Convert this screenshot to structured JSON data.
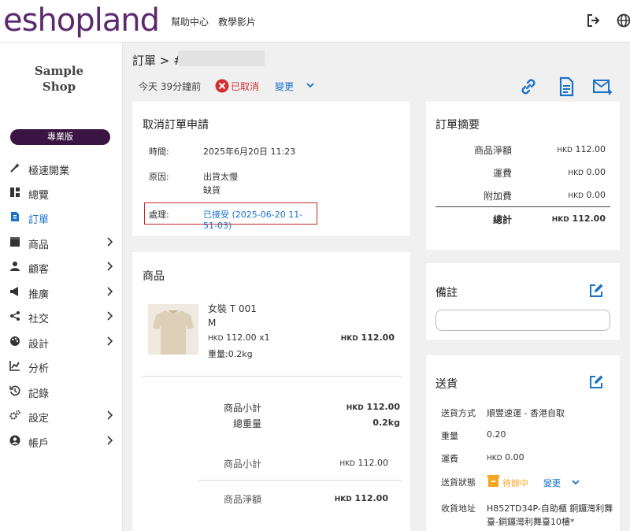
{
  "header": {
    "logo": "eshopland",
    "help_link": "幫助中心",
    "tutorial_link": "教學影片",
    "logout_icon": "logout-icon",
    "language_icon": "globe-icon"
  },
  "sidebar": {
    "shop_name_line1": "Sample",
    "shop_name_line2": "Shop",
    "plan_label": "專業版",
    "items": [
      {
        "label": "極速開業",
        "icon": "magic-wand-icon",
        "has_children": false
      },
      {
        "label": "總覽",
        "icon": "dashboard-icon",
        "has_children": false
      },
      {
        "label": "訂單",
        "icon": "order-document-icon",
        "has_children": false,
        "active": true
      },
      {
        "label": "商品",
        "icon": "box-icon",
        "has_children": true
      },
      {
        "label": "顧客",
        "icon": "user-icon",
        "has_children": true
      },
      {
        "label": "推廣",
        "icon": "megaphone-icon",
        "has_children": true
      },
      {
        "label": "社交",
        "icon": "share-icon",
        "has_children": true
      },
      {
        "label": "設計",
        "icon": "palette-icon",
        "has_children": true
      },
      {
        "label": "分析",
        "icon": "chart-icon",
        "has_children": false
      },
      {
        "label": "記錄",
        "icon": "history-icon",
        "has_children": false
      },
      {
        "label": "設定",
        "icon": "gears-icon",
        "has_children": true
      },
      {
        "label": "帳戶",
        "icon": "account-icon",
        "has_children": true
      }
    ],
    "active_color": "#1a73c8",
    "plan_color": "#3a1442"
  },
  "breadcrumb": {
    "text": "訂單 > #"
  },
  "status_bar": {
    "time": "今天 39分鐘前",
    "status": "已取消",
    "change": "變更"
  },
  "cancel_request": {
    "title": "取消訂單申請",
    "time_label": "時間:",
    "time_value": "2025年6月20日 11:23",
    "reason_label": "原因:",
    "reason_line1": "出貨太慢",
    "reason_line2": "缺貨",
    "process_label": "處理:",
    "process_value": "已接受 (2025-06-20 11-51-03)"
  },
  "products": {
    "title": "商品",
    "item": {
      "name": "女裝 T 001",
      "size": "M",
      "currency": "HKD",
      "price_qty": "112.00 x1",
      "weight": "重量:0.2kg",
      "total_currency": "HKD",
      "total": "112.00",
      "image": "beige-tshirt-photo"
    },
    "subtotal_label": "商品小計",
    "subtotal_currency": "HKD",
    "subtotal_value": "112.00",
    "total_weight_label": "總重量",
    "total_weight_value": "0.2kg",
    "subtotal2_label": "商品小計",
    "subtotal2_currency": "HKD",
    "subtotal2_value": "112.00",
    "net_label": "商品淨額",
    "net_currency": "HKD",
    "net_value": "112.00"
  },
  "summary": {
    "title": "訂單摘要",
    "rows": [
      {
        "label": "商品淨額",
        "currency": "HKD",
        "value": "112.00"
      },
      {
        "label": "運費",
        "currency": "HKD",
        "value": "0.00"
      },
      {
        "label": "附加費",
        "currency": "HKD",
        "value": "0.00"
      }
    ],
    "total_label": "總計",
    "total_currency": "HKD",
    "total_value": "112.00"
  },
  "notes": {
    "title": "備註",
    "placeholder": ""
  },
  "shipping": {
    "title": "送貨",
    "method_label": "送貨方式",
    "method_value": "順豐速運 - 香港自取",
    "weight_label": "重量",
    "weight_value": "0.20",
    "fee_label": "運費",
    "fee_currency": "HKD",
    "fee_value": "0.00",
    "status_label": "送貨狀態",
    "status_value": "待辦中",
    "status_change": "變更",
    "address_label": "收貨地址",
    "address_line1": "H852TD34P-自助櫃 銅鑼灣利舞",
    "address_line2": "臺-銅鑼灣利舞臺10樓*",
    "status_color": "#f5a623"
  }
}
